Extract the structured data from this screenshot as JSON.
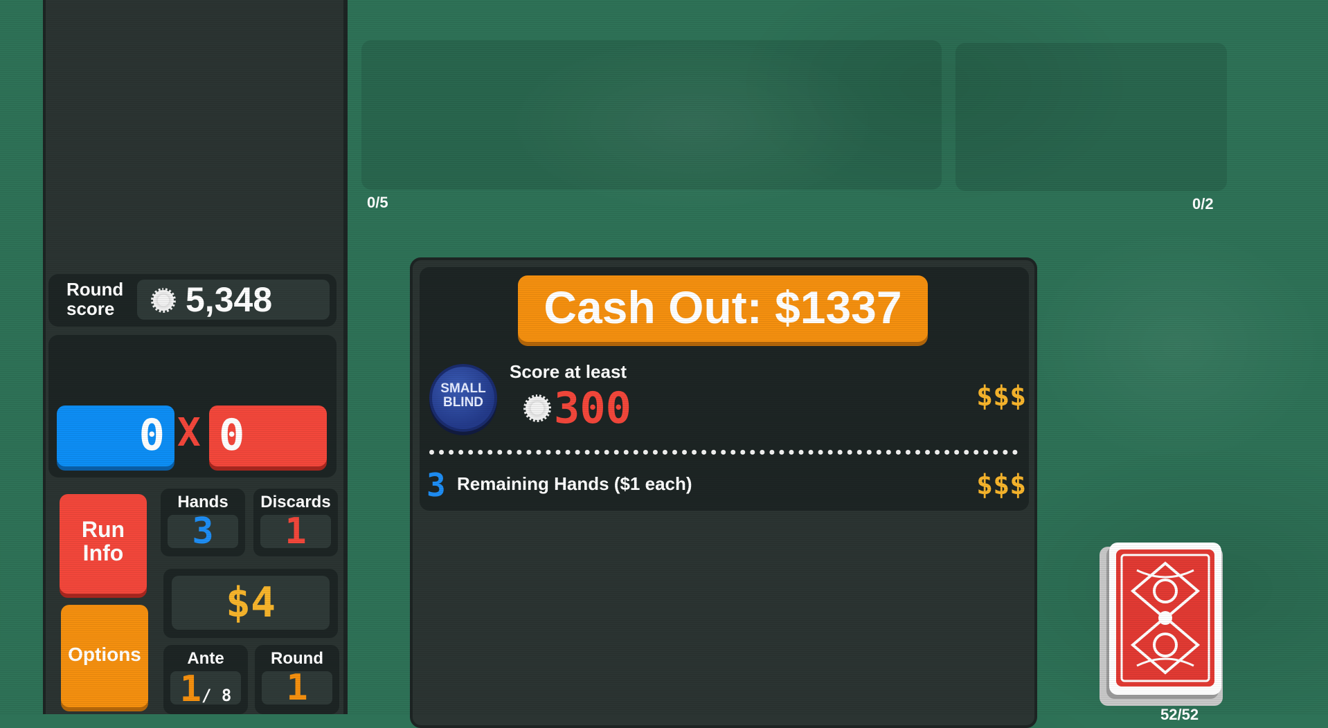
{
  "sidebar": {
    "round_score_label_line1": "Round",
    "round_score_label_line2": "score",
    "round_score_value": "5,348",
    "chips": "0",
    "times": "X",
    "mult": "0",
    "run_info_line1": "Run",
    "run_info_line2": "Info",
    "options_label": "Options",
    "hands_label": "Hands",
    "hands_value": "3",
    "discards_label": "Discards",
    "discards_value": "1",
    "money": "$4",
    "ante_label": "Ante",
    "ante_value": "1",
    "ante_max": "/ 8",
    "round_label": "Round",
    "round_value": "1",
    "colors": {
      "chips": "#0d8ef5",
      "mult": "#f3473b",
      "money": "#f7b52c",
      "options": "#f5900f"
    }
  },
  "areas": {
    "joker_count": "0/5",
    "consumable_count": "0/2"
  },
  "cash_out": {
    "button_label": "Cash Out: $1337",
    "blind_chip_line1": "SMALL",
    "blind_chip_line2": "BLIND",
    "score_at_least": "Score at least",
    "target_score": "300",
    "blind_reward": "$$$",
    "remaining_hands_count": "3",
    "remaining_hands_label": "Remaining Hands ($1 each)",
    "hands_reward": "$$$"
  },
  "deck": {
    "count": "52/52"
  },
  "icons": [
    "chip-icon",
    "small-blind-chip",
    "deck-card-back"
  ]
}
